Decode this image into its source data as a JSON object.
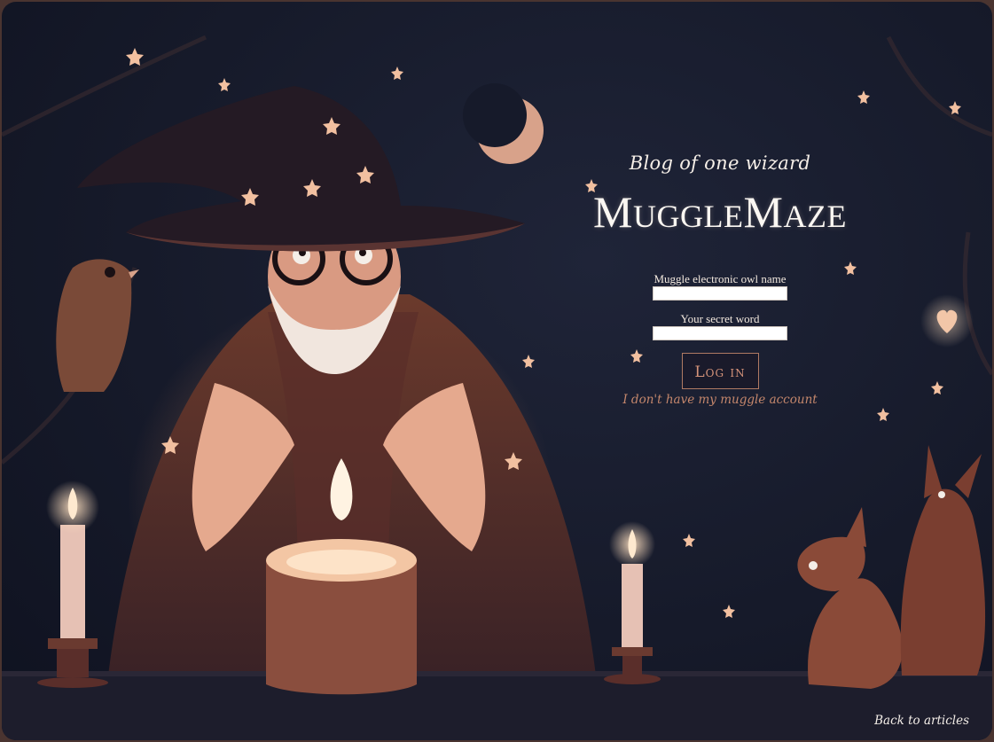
{
  "header": {
    "tagline": "Blog of one wizard",
    "title_part1_cap": "M",
    "title_part1_rest": "uggle",
    "title_part2_cap": "M",
    "title_part2_rest": "aze"
  },
  "login_form": {
    "username_label": "Muggle electronic owl name",
    "username_value": "",
    "password_label": "Your secret word",
    "password_value": "",
    "submit_label": "Log in",
    "no_account_link": "I don't have my muggle account"
  },
  "footer": {
    "back_link": "Back to articles"
  },
  "theme": {
    "background": "#161a2a",
    "accent": "#c5876c",
    "text": "#f4ece4"
  },
  "illustration": {
    "icons": [
      "wizard-illustration",
      "candle-icon",
      "moon-icon",
      "owl-icon",
      "fox-icon",
      "star-icon",
      "heart-icon"
    ]
  }
}
